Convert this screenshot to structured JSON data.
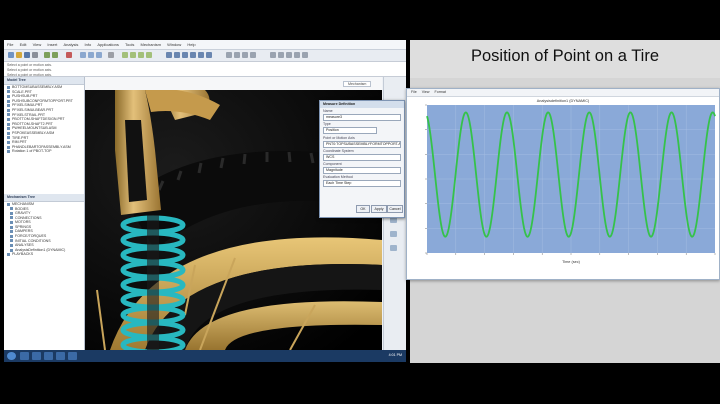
{
  "slide": {
    "title": "Position of Point on a Tire"
  },
  "app": {
    "menu": [
      "File",
      "Edit",
      "View",
      "Insert",
      "Analysis",
      "Info",
      "Applications",
      "Tools",
      "Mechanism",
      "Window",
      "Help"
    ],
    "status_lines": [
      "Select a point or motion axis.",
      "Select a point or motion axis.",
      "Select a point or motion axis."
    ],
    "model_tree_header": "Model Tree",
    "model_tree_items": [
      "BOTTOMSUBASSEMBLY.ASM",
      "SCALE.PRT",
      "PUSHSUB.PRT",
      "PUSHSUBCONFORMTOPPORT.PRT",
      "PFIXELSIMULPRT",
      "PFIXELSIMULBEAR.PRT",
      "PFIXELSTRAIL.PRT",
      "PBOTTOM-SHAFTDESIGN.PRT",
      "PBOTTOM-SHAFT2.PRT",
      "PWHEELMOUNTSUB.ASM",
      "PSPOKEASSEMBLY.ASM",
      "TIRE.PRT",
      "RIM.PRT",
      "PHANDLEBARTOPASSEMBLY.ASM",
      "Rotation 1 of PBOT-TOP"
    ],
    "mechanism_tree_header": "Mechanism Tree",
    "mechanism_tree_items": [
      "MECHANISM",
      "BODIES",
      "GRAVITY",
      "CONNECTIONS",
      "MOTORS",
      "SPRINGS",
      "DAMPERS",
      "FORCE/TORQUES",
      "INITIAL CONDITIONS",
      "ANALYSES",
      "AnalysisDefinition1 (DYNAMIC)",
      "PLAYBACKS"
    ],
    "viewport_tab": "Mechanism",
    "clock": "4:01 PM"
  },
  "dialog": {
    "title": "Measure Definition",
    "name_label": "Name",
    "name_value": "measure3",
    "type_label": "Type",
    "type_value": "Position",
    "point_label": "Point or Motion Axis",
    "point_value": "PNT0:TOPSUBASSEMBLYFORMTOPPORT.ASM",
    "coord_label": "Coordinate System",
    "coord_value": "WCS",
    "component_label": "Component",
    "component_value": "Magnitude",
    "eval_label": "Evaluation Method",
    "eval_value": "Each Time Step",
    "ok": "OK",
    "apply": "Apply",
    "cancel": "Cancel"
  },
  "graph_window": {
    "menu": [
      "File",
      "View",
      "Format"
    ],
    "plot_title": "Analysisdefinition1 (DYNAMIC)",
    "xlabel": "Time (sec)"
  },
  "chart_data": {
    "type": "line",
    "series": [
      {
        "color": "#35c24a"
      }
    ],
    "periods": 7,
    "ylim": [
      0,
      1
    ],
    "xlim": [
      0,
      7
    ],
    "grid": true
  },
  "colors": {
    "plot_bg": "#8aa9d8",
    "curve": "#35c24a",
    "tire": "#d9b05a",
    "spring": "#28b8c0"
  }
}
